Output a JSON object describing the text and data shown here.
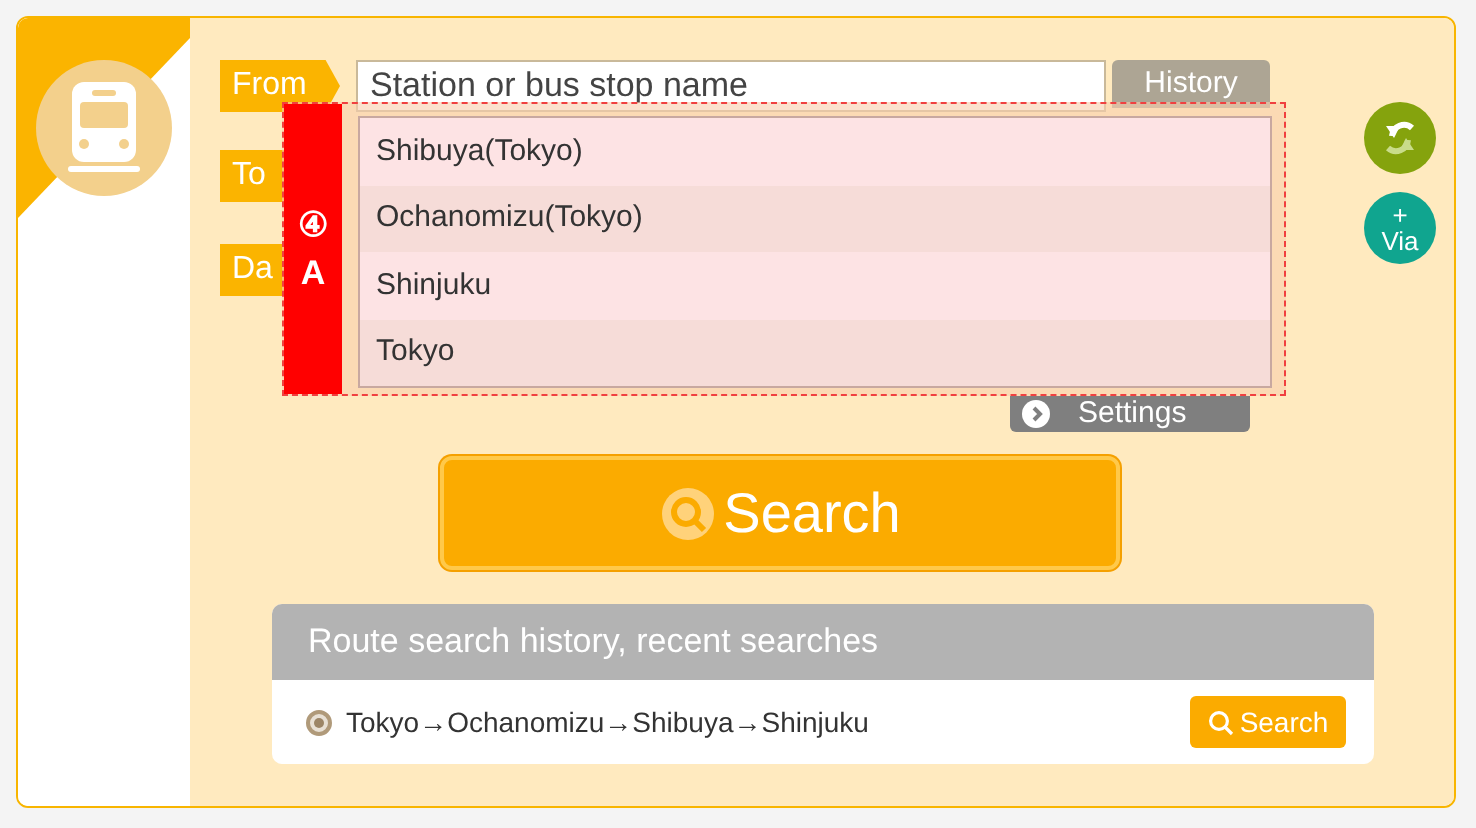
{
  "from": {
    "label": "From",
    "placeholder": "Station or bus stop name",
    "history_button": "History"
  },
  "to": {
    "label": "To"
  },
  "date": {
    "label": "Da"
  },
  "settings_button": "Settings",
  "search_button": "Search",
  "via_button": {
    "plus": "+",
    "label": "Via"
  },
  "suggestions": [
    {
      "text": "Shibuya(Tokyo)"
    },
    {
      "text": "Ochanomizu(Tokyo)"
    },
    {
      "text": "Shinjuku"
    },
    {
      "text": "Tokyo"
    }
  ],
  "annotation": {
    "number": "④",
    "letter": "A"
  },
  "history": {
    "title": "Route search history, recent searches",
    "items": [
      {
        "route": "Tokyo→Ochanomizu→Shibuya→Shinjuku",
        "selected": true,
        "button": "Search"
      }
    ]
  }
}
